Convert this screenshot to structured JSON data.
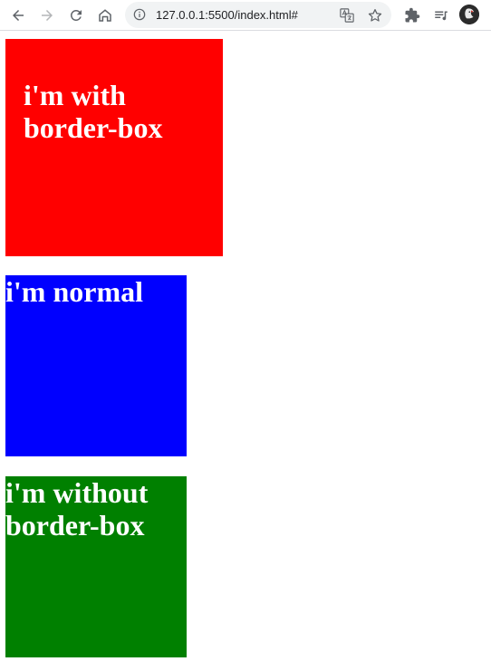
{
  "browser": {
    "url": "127.0.0.1:5500/index.html#"
  },
  "page": {
    "boxes": [
      {
        "text": "i'm with border-box",
        "color": "#ff0000"
      },
      {
        "text": "i'm normal",
        "color": "#0000ff"
      },
      {
        "text": "i'm without border-box",
        "color": "#008000"
      }
    ]
  }
}
